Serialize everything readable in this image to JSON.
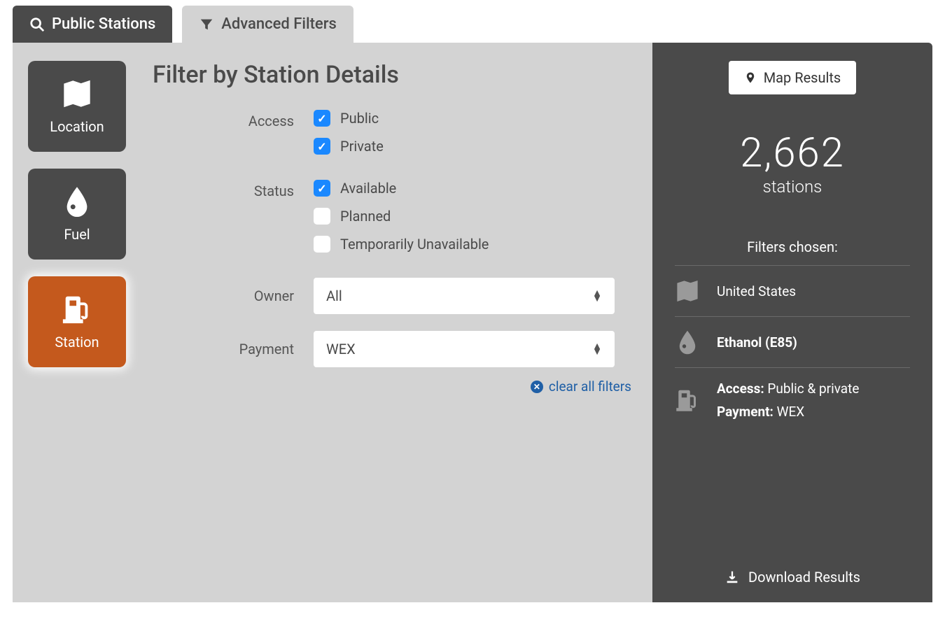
{
  "tabs": {
    "public": "Public Stations",
    "advanced": "Advanced Filters"
  },
  "sidebar": {
    "location": "Location",
    "fuel": "Fuel",
    "station": "Station"
  },
  "form": {
    "title": "Filter by Station Details",
    "access_label": "Access",
    "access_public": "Public",
    "access_private": "Private",
    "status_label": "Status",
    "status_available": "Available",
    "status_planned": "Planned",
    "status_temp": "Temporarily Unavailable",
    "owner_label": "Owner",
    "owner_value": "All",
    "payment_label": "Payment",
    "payment_value": "WEX",
    "clear": "clear all filters"
  },
  "results": {
    "map_btn": "Map Results",
    "count": "2,662",
    "count_sub": "stations",
    "filters_title": "Filters chosen:",
    "f_location": "United States",
    "f_fuel": "Ethanol (E85)",
    "f_access_label": "Access:",
    "f_access_val": " Public & private",
    "f_payment_label": "Payment:",
    "f_payment_val": " WEX",
    "download": "Download Results"
  }
}
